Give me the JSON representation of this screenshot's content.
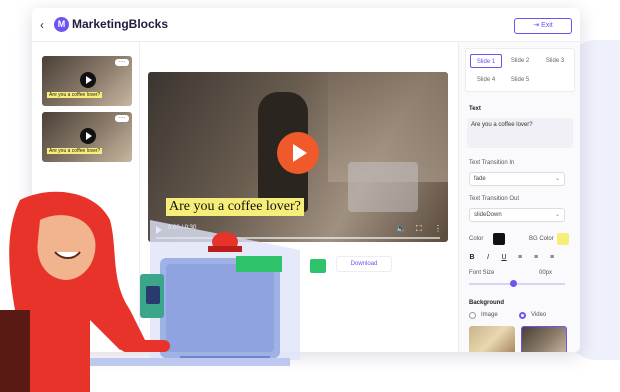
{
  "header": {
    "back_glyph": "‹",
    "brand": "MarketingBlocks",
    "exit_label": "Exit",
    "accent_color": "#6b54f0"
  },
  "thumbnails": [
    {
      "caption": "Are you a coffee lover?"
    },
    {
      "caption": "Are you a coffee lover?"
    }
  ],
  "video": {
    "caption": "Are you a coffee lover?",
    "time": "0:00 / 0:30",
    "play_color": "#f05a2a"
  },
  "actions": {
    "download_label": "Download"
  },
  "slides": [
    "Slide 1",
    "Slide 2",
    "Slide 3",
    "Slide 4",
    "Slide 5"
  ],
  "text_panel": {
    "section_title": "Text",
    "text_value": "Are you a coffee lover?",
    "transition_in_label": "Text Transition In",
    "transition_in_value": "fade",
    "transition_out_label": "Text Transition Out",
    "transition_out_value": "slideDown",
    "color_label": "Color",
    "color_value": "#111111",
    "bg_color_label": "BG Color",
    "bg_color_value": "#f7ee7a",
    "font_size_label": "Font Size",
    "font_size_value": "00px"
  },
  "background_panel": {
    "section_title": "Background",
    "option_image": "Image",
    "option_video": "Video"
  }
}
